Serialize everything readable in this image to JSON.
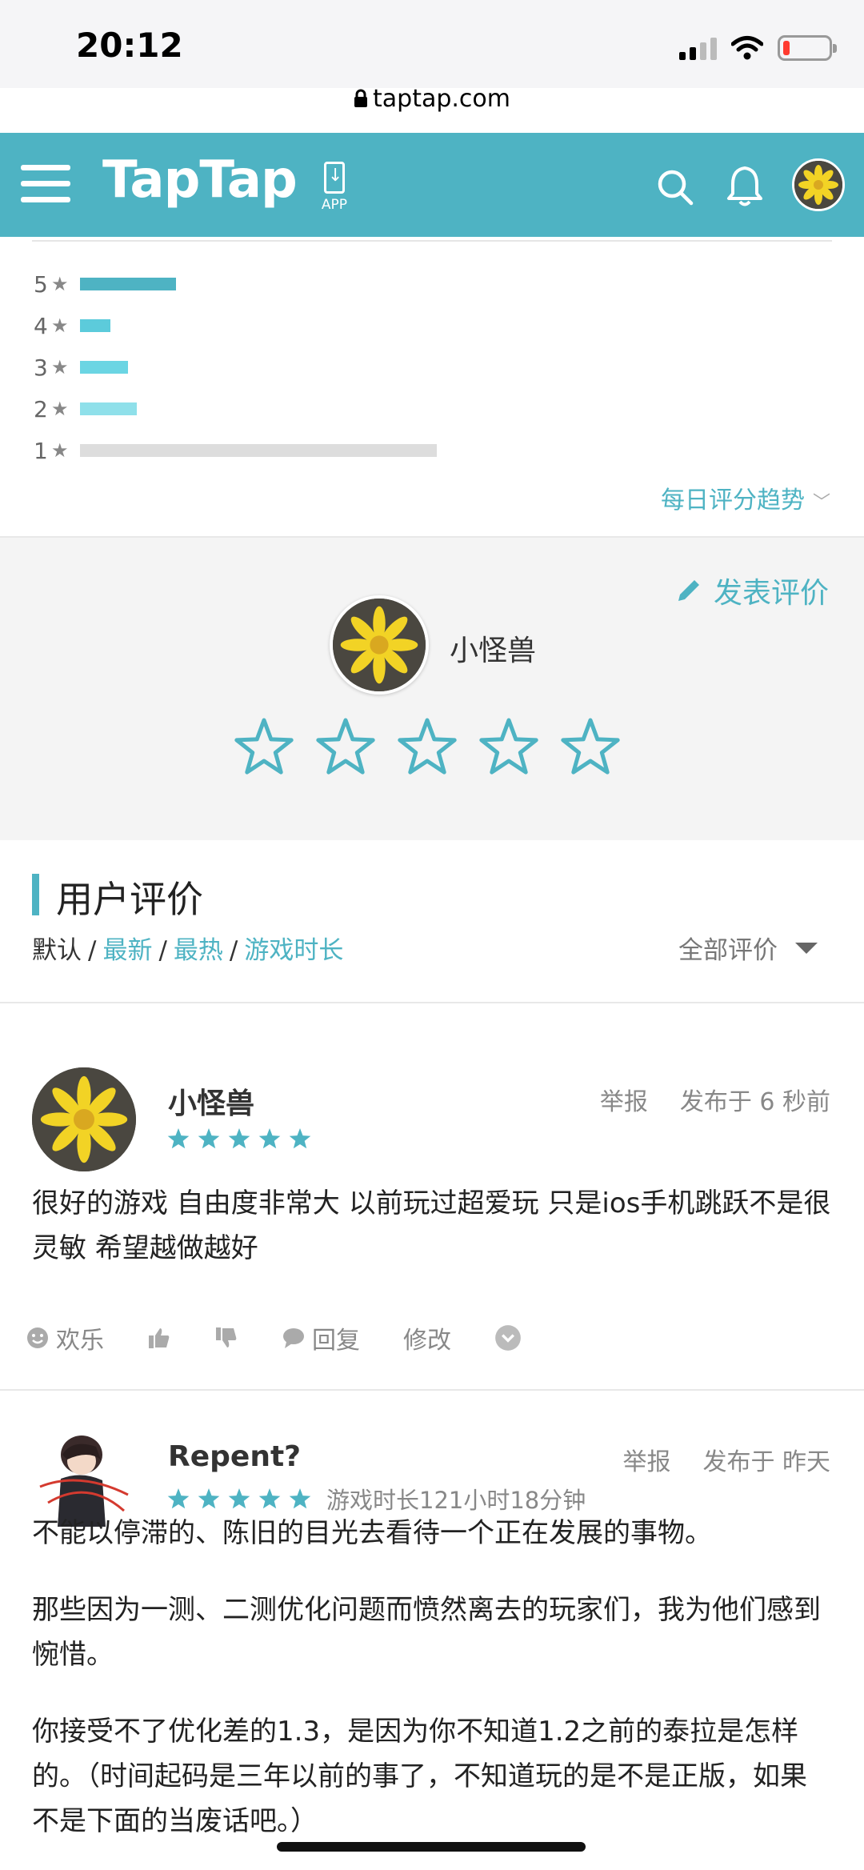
{
  "status_bar": {
    "time": "20:12"
  },
  "browser": {
    "url": "taptap.com"
  },
  "header": {
    "logo": "TapTap",
    "app_label": "APP"
  },
  "rating_distribution": {
    "rows": [
      {
        "stars": "5",
        "fraction": 0.27,
        "color": "#4eb3c3"
      },
      {
        "stars": "4",
        "fraction": 0.085,
        "color": "#5ccbdb"
      },
      {
        "stars": "3",
        "fraction": 0.135,
        "color": "#6bd5e3"
      },
      {
        "stars": "2",
        "fraction": 0.16,
        "color": "#8fe0ea"
      },
      {
        "stars": "1",
        "fraction": 1.0,
        "color": "#dddddd"
      }
    ],
    "trend_label": "每日评分趋势"
  },
  "write_review": {
    "label": "发表评价",
    "username": "小怪兽",
    "star_count": 5
  },
  "reviews_section": {
    "title": "用户评价",
    "sort_default": "默认",
    "sort_options": [
      "最新",
      "最热",
      "游戏时长"
    ],
    "filter_label": "全部评价"
  },
  "reviews": [
    {
      "name": "小怪兽",
      "rating": 5,
      "playtime": "",
      "report": "举报",
      "time": "发布于 6 秒前",
      "body": [
        "很好的游戏 自由度非常大 以前玩过超爱玩 只是ios手机跳跃不是很灵敏 希望越做越好"
      ],
      "actions": {
        "fun": "欢乐",
        "reply": "回复",
        "edit": "修改"
      }
    },
    {
      "name": "Repent?",
      "rating": 5,
      "playtime": "游戏时长121小时18分钟",
      "report": "举报",
      "time": "发布于 昨天",
      "body": [
        "不能以停滞的、陈旧的目光去看待一个正在发展的事物。",
        "那些因为一测、二测优化问题而愤然离去的玩家们，我为他们感到惋惜。",
        "你接受不了优化差的1.3，是因为你不知道1.2之前的泰拉是怎样的。（时间起码是三年以前的事了，不知道玩的是不是正版，如果不是下面的当废话吧。）"
      ]
    }
  ],
  "colors": {
    "accent": "#4eb3c3",
    "header_bg": "#4eb3c3"
  }
}
